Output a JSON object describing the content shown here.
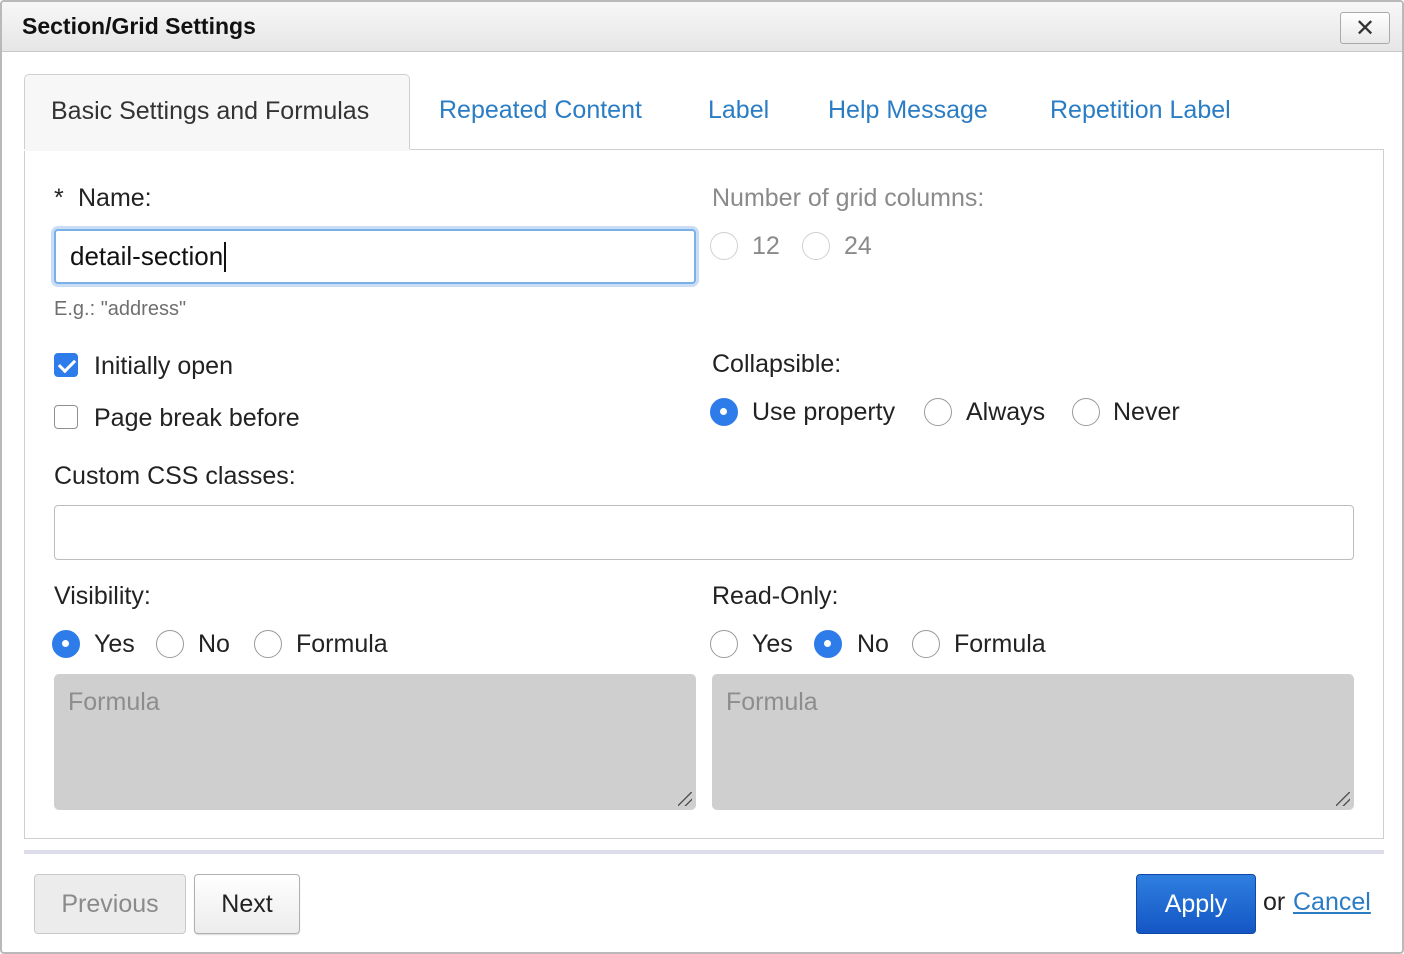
{
  "dialog": {
    "title": "Section/Grid Settings",
    "close_label": "✕"
  },
  "tabs": [
    {
      "label": "Basic Settings and Formulas",
      "active": true
    },
    {
      "label": "Repeated Content"
    },
    {
      "label": "Label"
    },
    {
      "label": "Help Message"
    },
    {
      "label": "Repetition Label"
    }
  ],
  "name": {
    "required_mark": "*",
    "label": "Name:",
    "value": "detail-section",
    "hint": "E.g.: \"address\""
  },
  "grid_columns": {
    "label": "Number of grid columns:",
    "options": [
      "12",
      "24"
    ]
  },
  "checkboxes": {
    "initially_open": {
      "label": "Initially open",
      "checked": true
    },
    "page_break_before": {
      "label": "Page break before",
      "checked": false
    }
  },
  "collapsible": {
    "label": "Collapsible:",
    "options": [
      "Use property",
      "Always",
      "Never"
    ],
    "selected": "Use property"
  },
  "css_classes": {
    "label": "Custom CSS classes:",
    "value": ""
  },
  "visibility": {
    "label": "Visibility:",
    "options": [
      "Yes",
      "No",
      "Formula"
    ],
    "selected": "Yes",
    "formula_placeholder": "Formula"
  },
  "readonly": {
    "label": "Read-Only:",
    "options": [
      "Yes",
      "No",
      "Formula"
    ],
    "selected": "No",
    "formula_placeholder": "Formula"
  },
  "footer": {
    "previous_label": "Previous",
    "next_label": "Next",
    "apply_label": "Apply",
    "or_text": "or",
    "cancel_label": "Cancel"
  },
  "colors": {
    "accent": "#2e7ce9",
    "link": "#2a7dc4",
    "apply_button": "#1a62cf"
  }
}
